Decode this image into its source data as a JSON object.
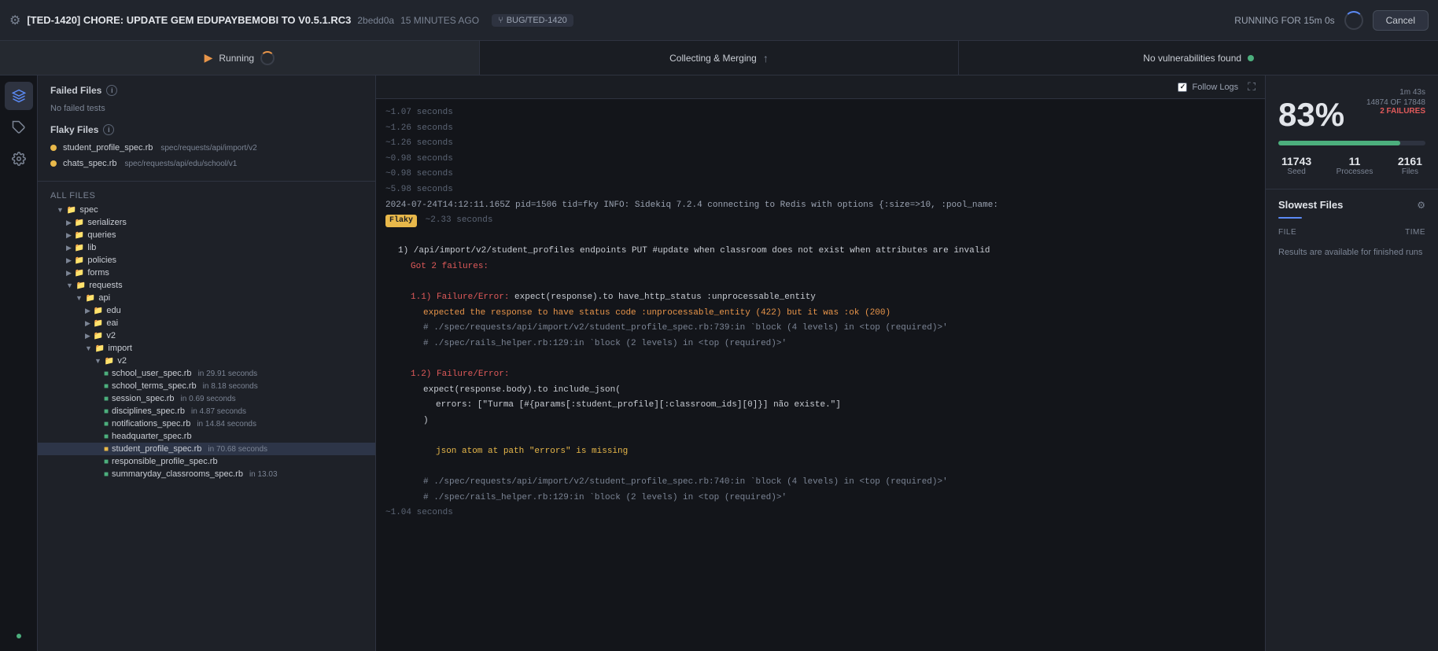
{
  "topbar": {
    "icon": "⚙",
    "title": "[TED-1420] CHORE: UPDATE GEM EDUPAYBEMOBI TO V0.5.1.RC3",
    "commit": "2bedd0a",
    "time_ago": "15 MINUTES AGO",
    "branch_icon": "⑂",
    "branch": "BUG/TED-1420",
    "running_label": "RUNNING FOR 15m 0s",
    "cancel_label": "Cancel"
  },
  "status_bar": {
    "item1_label": "Running",
    "item2_label": "Collecting & Merging",
    "item3_label": "No vulnerabilities found"
  },
  "sidebar": {
    "failed_section": "Failed Files",
    "no_failed": "No failed tests",
    "flaky_section": "Flaky Files",
    "flaky_items": [
      {
        "name": "student_profile_spec.rb",
        "path": "spec/requests/api/import/v2"
      },
      {
        "name": "chats_spec.rb",
        "path": "spec/requests/api/edu/school/v1"
      }
    ],
    "all_files_label": "All files",
    "tree": [
      {
        "indent": 1,
        "type": "folder",
        "name": "spec",
        "expanded": true
      },
      {
        "indent": 2,
        "type": "folder",
        "name": "serializers"
      },
      {
        "indent": 2,
        "type": "folder",
        "name": "queries"
      },
      {
        "indent": 2,
        "type": "folder",
        "name": "lib"
      },
      {
        "indent": 2,
        "type": "folder",
        "name": "policies"
      },
      {
        "indent": 2,
        "type": "folder",
        "name": "forms"
      },
      {
        "indent": 2,
        "type": "folder",
        "name": "requests",
        "expanded": true
      },
      {
        "indent": 3,
        "type": "folder",
        "name": "api",
        "expanded": true
      },
      {
        "indent": 4,
        "type": "folder",
        "name": "edu"
      },
      {
        "indent": 4,
        "type": "folder",
        "name": "eai"
      },
      {
        "indent": 4,
        "type": "folder",
        "name": "v2"
      },
      {
        "indent": 4,
        "type": "folder",
        "name": "import",
        "expanded": true
      },
      {
        "indent": 5,
        "type": "folder",
        "name": "v2",
        "expanded": true
      },
      {
        "indent": 6,
        "type": "file",
        "name": "school_user_spec.rb",
        "time": "in 29.91 seconds"
      },
      {
        "indent": 6,
        "type": "file",
        "name": "school_terms_spec.rb",
        "time": "in 8.18 seconds"
      },
      {
        "indent": 6,
        "type": "file",
        "name": "session_spec.rb",
        "time": "in 0.69 seconds"
      },
      {
        "indent": 6,
        "type": "file",
        "name": "disciplines_spec.rb",
        "time": "in 4.87 seconds"
      },
      {
        "indent": 6,
        "type": "file",
        "name": "notifications_spec.rb",
        "time": "in 14.84 seconds"
      },
      {
        "indent": 6,
        "type": "file",
        "name": "headquarter_spec.rb"
      },
      {
        "indent": 6,
        "type": "file",
        "name": "student_profile_spec.rb",
        "time": "in 70.68 seconds",
        "highlight": true
      },
      {
        "indent": 6,
        "type": "file",
        "name": "responsible_profile_spec.rb"
      },
      {
        "indent": 6,
        "type": "file",
        "name": "summaryday_classrooms_spec.rb",
        "time": "in 13.03"
      }
    ]
  },
  "log": {
    "follow_logs": "Follow Logs",
    "lines": [
      {
        "type": "time",
        "text": "~1.07 seconds"
      },
      {
        "type": "time",
        "text": "~1.26 seconds"
      },
      {
        "type": "time",
        "text": "~1.26 seconds"
      },
      {
        "type": "time",
        "text": "~0.98 seconds"
      },
      {
        "type": "time",
        "text": "~0.98 seconds"
      },
      {
        "type": "time",
        "text": "~5.98 seconds"
      },
      {
        "type": "info",
        "text": "2024-07-24T14:12:11.165Z pid=1506 tid=fky INFO: Sidekiq 7.2.4 connecting to Redis with options {:size=>10, :pool_name:"
      },
      {
        "type": "flaky_time",
        "badge": "Flaky",
        "text": "~2.33 seconds"
      },
      {
        "type": "normal",
        "text": ""
      },
      {
        "type": "failure_header",
        "text": "1) /api/import/v2/student_profiles endpoints PUT #update when classroom does not exist when attributes are invalid"
      },
      {
        "type": "failure_sub",
        "text": "Got 2 failures:"
      },
      {
        "type": "normal",
        "text": ""
      },
      {
        "type": "failure_1",
        "text": "1.1) Failure/Error: expect(response).to have_http_status :unprocessable_entity"
      },
      {
        "type": "failure_detail",
        "text": "expected the response to have status code :unprocessable_entity (422) but it was :ok (200)"
      },
      {
        "type": "failure_trace",
        "text": "# ./spec/requests/api/import/v2/student_profile_spec.rb:739:in `block (4 levels) in <top (required)>'"
      },
      {
        "type": "failure_trace",
        "text": "# ./spec/rails_helper.rb:129:in `block (2 levels) in <top (required)>'"
      },
      {
        "type": "normal",
        "text": ""
      },
      {
        "type": "failure_1",
        "text": "1.2) Failure/Error:"
      },
      {
        "type": "failure_detail",
        "text": "expect(response.body).to include_json("
      },
      {
        "type": "failure_detail2",
        "text": "errors: [\"Turma [#{params[:student_profile][:classroom_ids][0]}] não existe.\"]"
      },
      {
        "type": "failure_detail",
        "text": ")"
      },
      {
        "type": "normal",
        "text": ""
      },
      {
        "type": "failure_yellow",
        "text": "json atom at path \"errors\" is missing"
      },
      {
        "type": "normal",
        "text": ""
      },
      {
        "type": "failure_trace",
        "text": "# ./spec/requests/api/import/v2/student_profile_spec.rb:740:in `block (4 levels) in <top (required)>'"
      },
      {
        "type": "failure_trace",
        "text": "# ./spec/rails_helper.rb:129:in `block (2 levels) in <top (required)>'"
      },
      {
        "type": "time",
        "text": "~1.04 seconds"
      }
    ]
  },
  "right_panel": {
    "time_label": "1m 43s",
    "percent": "83%",
    "tests_count": "14874 OF 17848",
    "failures": "2 FAILURES",
    "progress_percent": 83,
    "seed_label": "Seed",
    "seed_value": "11743",
    "processes_label": "Processes",
    "processes_value": "11",
    "files_label": "Files",
    "files_value": "2161",
    "slowest_files_title": "Slowest Files",
    "col_file": "FILE",
    "col_time": "TIME",
    "results_note": "Results are available for finished runs"
  }
}
